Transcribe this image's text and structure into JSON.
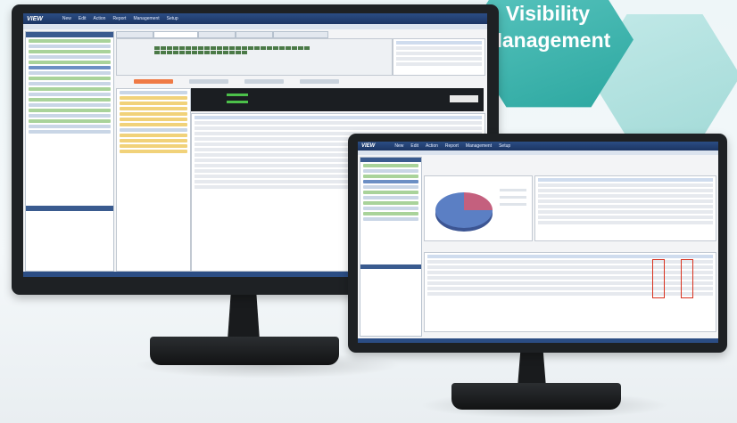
{
  "headline": {
    "line1": "Visibility",
    "line2": "Management"
  },
  "colors": {
    "hex_primary": "#2aa69f",
    "hex_secondary": "#8fd3cf",
    "menubar": "#2b4d84",
    "pie_blue": "#4f6fb4",
    "pie_red": "#c05a78"
  },
  "left_app": {
    "menu": [
      "New",
      "Edit",
      "Action",
      "Report",
      "Management",
      "Setup"
    ]
  },
  "right_app": {
    "menu": [
      "New",
      "Edit",
      "Action",
      "Report",
      "Management",
      "Setup"
    ]
  }
}
